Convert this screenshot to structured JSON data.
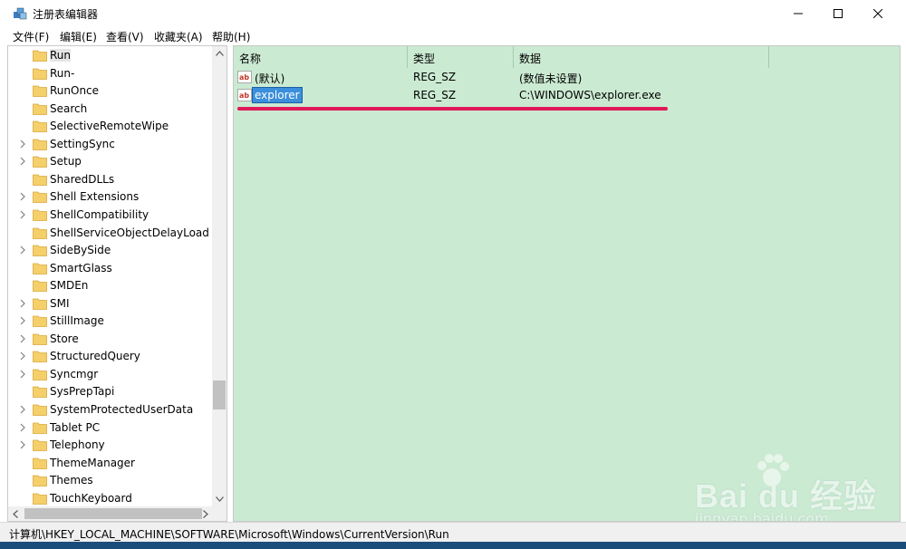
{
  "window": {
    "title": "注册表编辑器",
    "controls": {
      "minimize": "minimize",
      "maximize": "maximize",
      "close": "close"
    }
  },
  "menu": {
    "items": [
      {
        "label": "文件(F)"
      },
      {
        "label": "编辑(E)"
      },
      {
        "label": "查看(V)"
      },
      {
        "label": "收藏夹(A)"
      },
      {
        "label": "帮助(H)"
      }
    ]
  },
  "tree": {
    "items": [
      {
        "label": "Run",
        "expandable": false,
        "selected": true
      },
      {
        "label": "Run-",
        "expandable": false
      },
      {
        "label": "RunOnce",
        "expandable": false
      },
      {
        "label": "Search",
        "expandable": false
      },
      {
        "label": "SelectiveRemoteWipe",
        "expandable": false
      },
      {
        "label": "SettingSync",
        "expandable": true
      },
      {
        "label": "Setup",
        "expandable": true
      },
      {
        "label": "SharedDLLs",
        "expandable": false
      },
      {
        "label": "Shell Extensions",
        "expandable": true
      },
      {
        "label": "ShellCompatibility",
        "expandable": true
      },
      {
        "label": "ShellServiceObjectDelayLoad",
        "expandable": false
      },
      {
        "label": "SideBySide",
        "expandable": true
      },
      {
        "label": "SmartGlass",
        "expandable": false
      },
      {
        "label": "SMDEn",
        "expandable": false
      },
      {
        "label": "SMI",
        "expandable": true
      },
      {
        "label": "StillImage",
        "expandable": true
      },
      {
        "label": "Store",
        "expandable": true
      },
      {
        "label": "StructuredQuery",
        "expandable": true
      },
      {
        "label": "Syncmgr",
        "expandable": true
      },
      {
        "label": "SysPrepTapi",
        "expandable": false
      },
      {
        "label": "SystemProtectedUserData",
        "expandable": true
      },
      {
        "label": "Tablet PC",
        "expandable": true
      },
      {
        "label": "Telephony",
        "expandable": true
      },
      {
        "label": "ThemeManager",
        "expandable": false
      },
      {
        "label": "Themes",
        "expandable": false
      },
      {
        "label": "TouchKeyboard",
        "expandable": false
      }
    ]
  },
  "values": {
    "columns": [
      "名称",
      "类型",
      "数据"
    ],
    "rows": [
      {
        "name": "(默认)",
        "type": "REG_SZ",
        "data": "(数值未设置)",
        "icon": "string-value-icon"
      },
      {
        "name": "explorer",
        "type": "REG_SZ",
        "data": "C:\\WINDOWS\\explorer.exe",
        "icon": "string-value-icon",
        "editing": true
      }
    ]
  },
  "status": {
    "path": "计算机\\HKEY_LOCAL_MACHINE\\SOFTWARE\\Microsoft\\Windows\\CurrentVersion\\Run"
  },
  "watermark": {
    "logo_text": "Bai du 经验",
    "sub_text": "jingyan.baidu.com"
  },
  "colors": {
    "value_pane_bg": "#cbead2",
    "edit_highlight": "#3b8fdb",
    "annotation_underline": "#e0195a",
    "folder": "#f5cf6a"
  }
}
